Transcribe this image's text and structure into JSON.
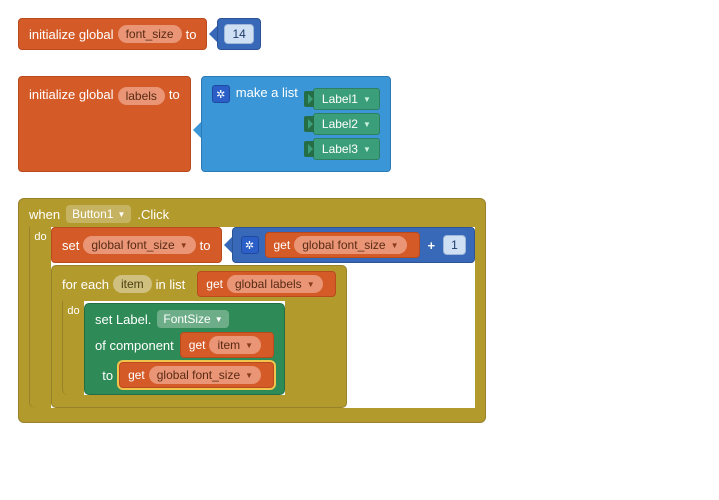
{
  "txt": {
    "init_global": "initialize global",
    "to": "to",
    "make_list": "make a list",
    "when": "when",
    "click": ".Click",
    "do": "do",
    "set": "set",
    "get": "get",
    "for_each": "for each",
    "in_list": "in list",
    "set_label": "set Label.",
    "of_component": "of component",
    "plus": "+"
  },
  "vars": {
    "font_size": "font_size",
    "labels": "labels",
    "item": "item",
    "global_font_size": "global font_size",
    "global_labels": "global labels"
  },
  "vals": {
    "fourteen": "14",
    "one": "1"
  },
  "labels_list": [
    "Label1",
    "Label2",
    "Label3"
  ],
  "event": {
    "component": "Button1",
    "prop": "FontSize"
  }
}
